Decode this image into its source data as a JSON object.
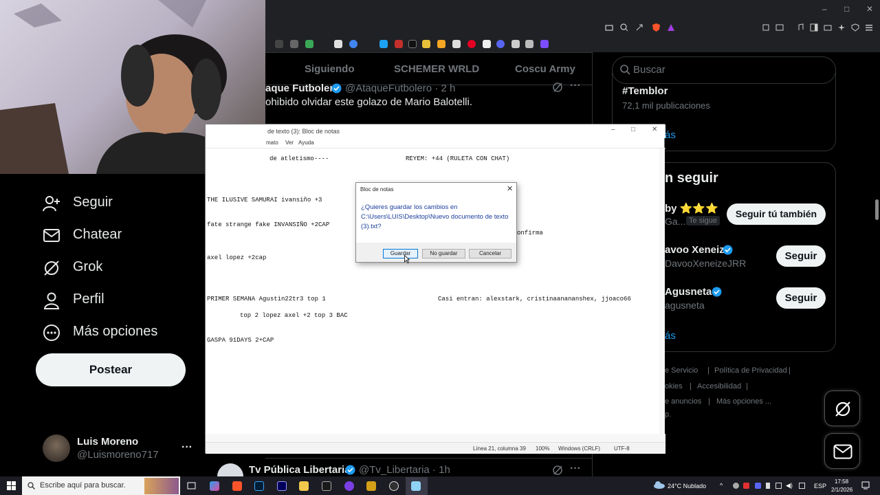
{
  "browser": {
    "window_controls": [
      "–",
      "□",
      "✕"
    ]
  },
  "x": {
    "tabs": [
      "Siguiendo",
      "SCHEMER WRLD",
      "Coscu Army"
    ],
    "tweet_top": {
      "name": "aque Futbolero",
      "handle": "@AtaqueFutbolero · 2 h",
      "text": "ohibido olvidar este golazo de Mario Balotelli."
    },
    "tweet_bottom": {
      "name": "Tv Pública Libertaria",
      "handle": "@Tv_Libertaria · 1h"
    },
    "search_placeholder": "Buscar",
    "trend": {
      "name": "#Temblor",
      "count": "72,1 mil publicaciones",
      "show_more": "ás"
    },
    "who_to_follow": {
      "title": "n seguir",
      "users": [
        {
          "name": "by ⭐⭐⭐",
          "handle": "Ga...",
          "badge": "Te sigue",
          "button": "Seguir tú también"
        },
        {
          "name": "avoo Xeneize",
          "handle": "DavooXeneizeJRR",
          "button": "Seguir"
        },
        {
          "name": "Agusneta",
          "handle": "agusneta",
          "button": "Seguir"
        }
      ],
      "show_more": "ás"
    },
    "footer": {
      "line1": [
        "e Servicio",
        "Política de Privacidad"
      ],
      "line2": [
        "okies",
        "Accesibilidad"
      ],
      "line3": [
        "e anuncios",
        "Más opciones ..."
      ],
      "line4": "p."
    },
    "nav": [
      {
        "label": "Seguir",
        "icon": "add-user-icon"
      },
      {
        "label": "Chatear",
        "icon": "mail-icon"
      },
      {
        "label": "Grok",
        "icon": "grok-icon"
      },
      {
        "label": "Perfil",
        "icon": "profile-icon"
      },
      {
        "label": "Más opciones",
        "icon": "more-circle-icon"
      }
    ],
    "post_button": "Postear",
    "account": {
      "name": "Luis Moreno",
      "handle": "@Luismoreno717",
      "menu": "···"
    }
  },
  "notepad": {
    "title": "de texto (3): Bloc de notas",
    "menu": [
      "mato",
      "Ver",
      "Ayuda"
    ],
    "lines": [
      "de atletismo----",
      "REYEM: +44 (RULETA CON CHAT)",
      "THE ILUSIVE SAMURAI ivansiño +3",
      "fate strange fake INVANSIÑO +2CAP",
      "onfirma",
      "axel lopez +2cap",
      "PRIMER SEMANA Agustin22tr3 top 1",
      "Casi entran: alexstark, cristinaanananshex, jjoaco66",
      "top 2 lopez axel +2 top 3 BAC",
      "GASPA 91DAYS 2+CAP"
    ],
    "status": {
      "position": "Línea 21, columna 39",
      "zoom": "100%",
      "eol": "Windows (CRLF)",
      "encoding": "UTF-8"
    }
  },
  "dialog": {
    "title": "Bloc de notas",
    "message": "¿Quieres guardar los cambios en C:\\Users\\LUIS\\Desktop\\Nuevo documento de texto (3).txt?",
    "buttons": {
      "save": "Guardar",
      "dont_save": "No guardar",
      "cancel": "Cancelar"
    }
  },
  "taskbar": {
    "search_placeholder": "Escribe aquí para buscar.",
    "weather": "24°C  Nublado",
    "language": "ESP",
    "time": "17:58",
    "date": "2/1/2026"
  },
  "colors": {
    "x_blue": "#1d9bf0",
    "x_text": "#e7e9ea",
    "x_muted": "#71767b",
    "dialog_text": "#1a3d9c"
  }
}
